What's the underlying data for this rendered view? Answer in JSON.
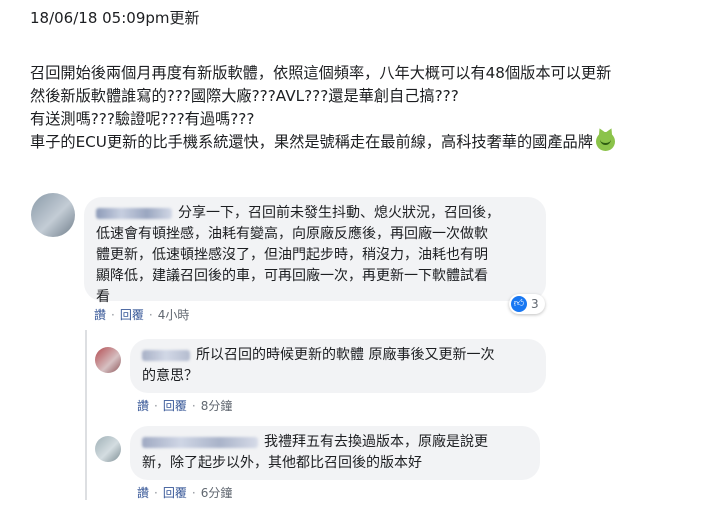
{
  "post": {
    "header": "18/06/18 05:09pm更新",
    "lines": [
      "召回開始後兩個月再度有新版軟體，依照這個頻率，八年大概可以有48個版本可以更新",
      "然後新版軟體誰寫的???國際大廠???AVL???還是華創自己搞???",
      "有送測嗎???驗證呢???有過嗎???",
      "車子的ECU更新的比手機系統還快，果然是號稱走在最前線，高科技奢華的國產品牌"
    ],
    "emoji_icon": "devil-grin-emoji"
  },
  "comments": [
    {
      "lines": [
        "分享一下，召回前未發生抖動、熄火狀況，召回後，",
        "低速會有頓挫感，油耗有變高，向原廠反應後，再回廠一次做軟",
        "體更新，低速頓挫感沒了，但油門起步時，稍沒力，油耗也有明",
        "顯降低，建議召回後的車，可再回廠一次，再更新一下軟體試看",
        "看"
      ],
      "like_label": "讚",
      "reply_label": "回覆",
      "time": "4小時",
      "reaction_count": "3"
    },
    {
      "lines": [
        "所以召回的時候更新的軟體 原廠事後又更新一次",
        "的意思？"
      ],
      "like_label": "讚",
      "reply_label": "回覆",
      "time": "8分鐘"
    },
    {
      "lines": [
        "我禮拜五有去換過版本，原廠是說更",
        "新，除了起步以外，其他都比召回後的版本好"
      ],
      "like_label": "讚",
      "reply_label": "回覆",
      "time": "6分鐘"
    }
  ],
  "colors": {
    "bubble": "#f2f3f5",
    "link": "#385898",
    "like_blue": "#1877f2"
  }
}
